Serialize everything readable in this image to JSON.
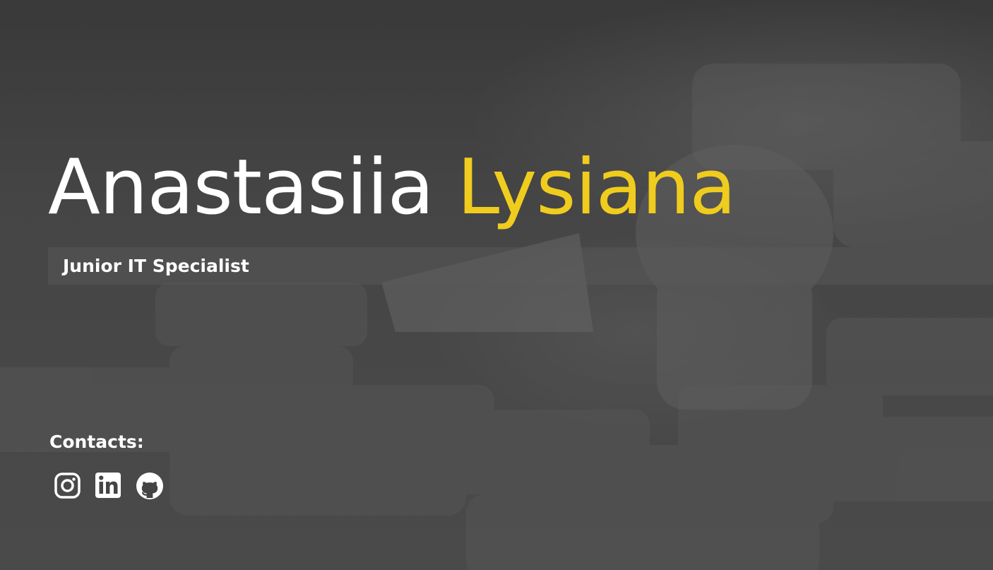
{
  "header": {
    "first_name": "Anastasiia",
    "last_name": "Lysiana",
    "subtitle": "Junior IT Specialist"
  },
  "contacts": {
    "label": "Contacts:",
    "links": [
      {
        "icon": "instagram-icon"
      },
      {
        "icon": "linkedin-icon"
      },
      {
        "icon": "github-icon"
      }
    ]
  },
  "colors": {
    "accent": "#f0cc1e",
    "text": "#ffffff",
    "background": "#444444"
  }
}
